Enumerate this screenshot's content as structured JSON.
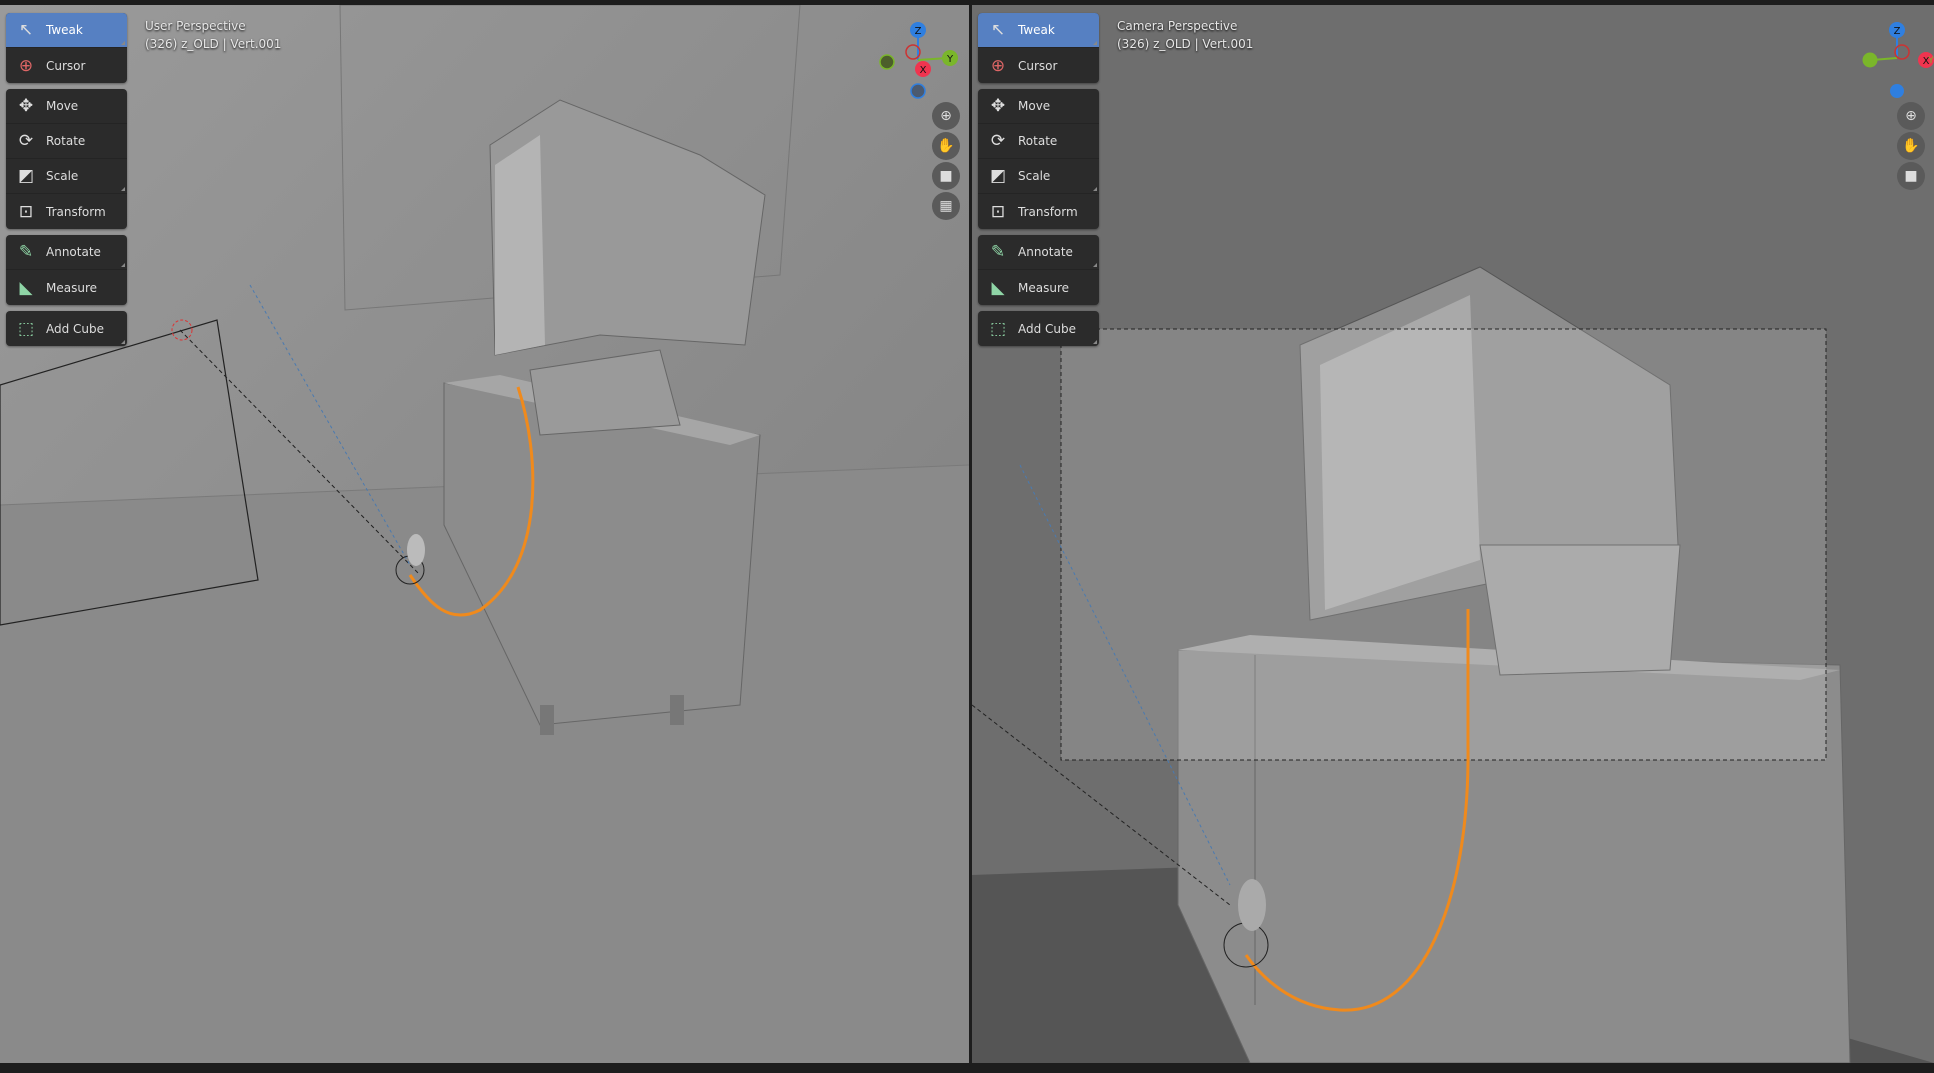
{
  "viewports": [
    {
      "title": "User Perspective",
      "info": "(326) z_OLD | Vert.001"
    },
    {
      "title": "Camera Perspective",
      "info": "(326) z_OLD | Vert.001"
    }
  ],
  "toolbar": {
    "groups": [
      [
        {
          "label": "Tweak",
          "icon": "tweak-icon",
          "active": true
        },
        {
          "label": "Cursor",
          "icon": "cursor-icon"
        }
      ],
      [
        {
          "label": "Move",
          "icon": "move-icon"
        },
        {
          "label": "Rotate",
          "icon": "rotate-icon"
        },
        {
          "label": "Scale",
          "icon": "scale-icon"
        },
        {
          "label": "Transform",
          "icon": "transform-icon"
        }
      ],
      [
        {
          "label": "Annotate",
          "icon": "annotate-icon"
        },
        {
          "label": "Measure",
          "icon": "measure-icon"
        }
      ],
      [
        {
          "label": "Add Cube",
          "icon": "add-cube-icon"
        }
      ]
    ]
  },
  "gizmo": {
    "x": "X",
    "y": "Y",
    "z": "Z",
    "colors": {
      "x": "#f0344f",
      "y": "#7ab62a",
      "z": "#2f7fe0"
    }
  },
  "nav_buttons": [
    "zoom-icon",
    "pan-hand-icon",
    "camera-icon",
    "grid-icon"
  ],
  "colors": {
    "accent": "#5680c2",
    "cable": "#f08a1c"
  }
}
